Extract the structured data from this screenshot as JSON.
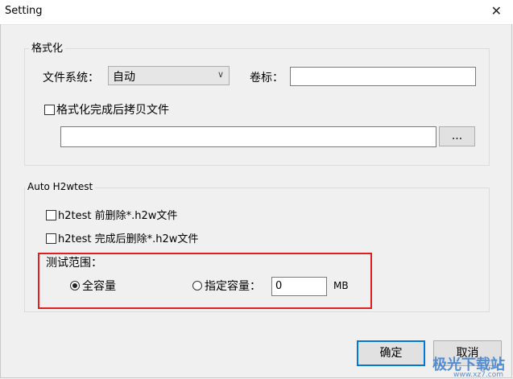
{
  "window": {
    "title": "Setting",
    "close_glyph": "✕"
  },
  "format_group": {
    "legend": "格式化",
    "fs_label": "文件系统：",
    "fs_value": "自动",
    "volume_label": "卷标：",
    "volume_value": "",
    "copy_checkbox_label": "格式化完成后拷贝文件",
    "copy_checked": false,
    "path_value": "",
    "browse_label": "..."
  },
  "h2w_group": {
    "legend": "Auto H2wtest",
    "delete_before_label": "h2test 前删除*.h2w文件",
    "delete_before_checked": false,
    "delete_after_label": "h2test 完成后删除*.h2w文件",
    "delete_after_checked": false,
    "range_label": "测试范围：",
    "full_capacity_label": "全容量",
    "full_capacity_selected": true,
    "specified_label": "指定容量：",
    "specified_selected": false,
    "specified_value": "0",
    "unit": "MB"
  },
  "footer": {
    "ok_label": "确定",
    "cancel_label": "取消"
  },
  "watermark": {
    "text": "极光下载站",
    "url": "www.xz7.com"
  }
}
